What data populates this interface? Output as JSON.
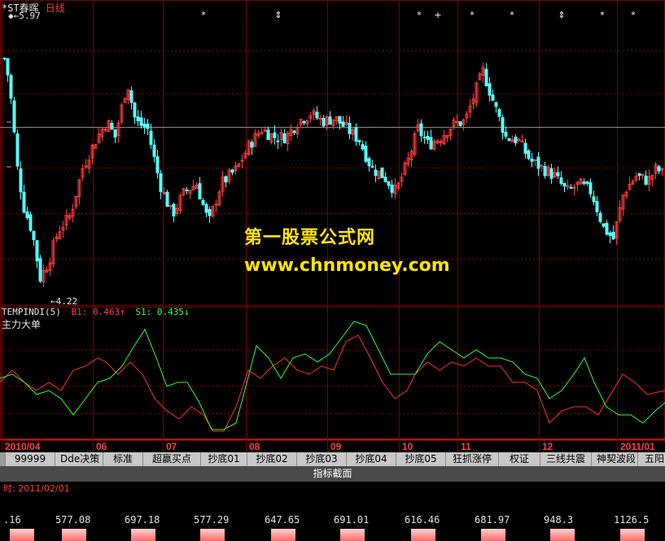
{
  "header": {
    "stock_name": "*ST春晖",
    "period": "日线",
    "high_label": "5.97",
    "low_label": "4.22"
  },
  "indicator_header": {
    "name": "TEMPINDI(5)",
    "b1": "B1: 0.463↑",
    "s1": "S1: 0.435↓",
    "subtitle": "主力大单"
  },
  "watermark": {
    "line1": "第一股票公式网",
    "line2": "www.chnmoney.com"
  },
  "colors": {
    "up": "#ff3c3c",
    "down": "#54ffff",
    "b1_line": "#ff3030",
    "s1_line": "#30ff30",
    "grid": "#7a0000"
  },
  "chart_data": {
    "type": "candlestick",
    "x_labels": [
      "2010/04",
      "06",
      "07",
      "08",
      "09",
      "10",
      "11",
      "12",
      "2011/01"
    ],
    "price_range": [
      4.22,
      5.97
    ],
    "marker_symbols": [
      "*",
      "⇕",
      "*",
      "+",
      "*",
      "*",
      "⇕",
      "*",
      "*"
    ],
    "indicator": {
      "name": "TEMPINDI(5)",
      "series": [
        {
          "name": "B1",
          "last": 0.463
        },
        {
          "name": "S1",
          "last": 0.435
        }
      ]
    }
  },
  "tabs": [
    "",
    "99999",
    "Dde决策",
    "标准",
    "超赢买点",
    "抄底01",
    "抄底02",
    "抄底03",
    "抄底04",
    "抄底05",
    "狂抓涨停",
    "权证",
    "三线共震",
    "神契波段",
    "五阳"
  ],
  "section_bar": "指标截面",
  "date_bar": "时: 2011/02/01",
  "bottom_values": [
    ".16",
    "577.08",
    "697.18",
    "577.29",
    "647.65",
    "691.01",
    "616.46",
    "681.97",
    "948.3",
    "1126.5"
  ]
}
